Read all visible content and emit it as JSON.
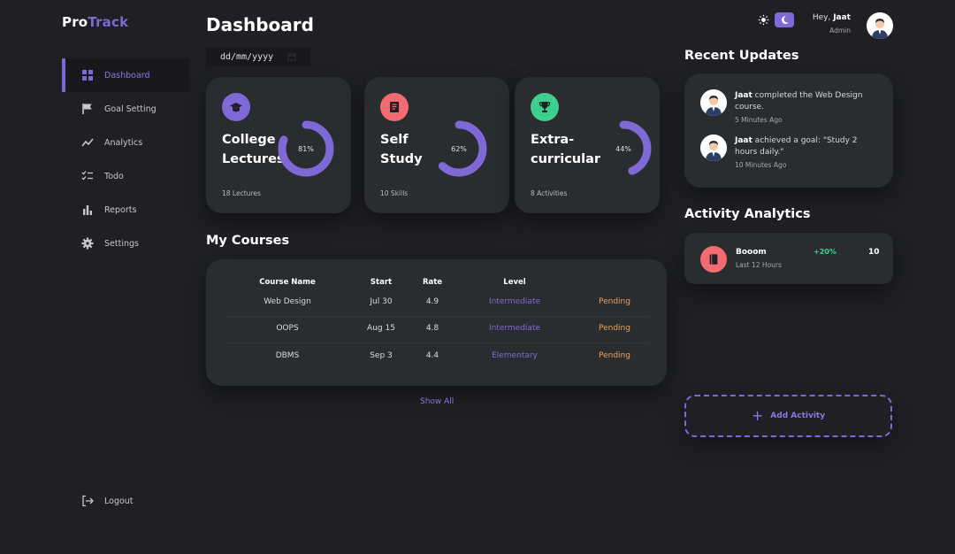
{
  "app": {
    "logo_pro": "Pro",
    "logo_track": "Track"
  },
  "sidebar": {
    "items": [
      {
        "label": "Dashboard",
        "icon": "grid-icon",
        "active": true
      },
      {
        "label": "Goal Setting",
        "icon": "flag-icon"
      },
      {
        "label": "Analytics",
        "icon": "line-chart-icon"
      },
      {
        "label": "Todo",
        "icon": "checklist-icon"
      },
      {
        "label": "Reports",
        "icon": "bar-chart-icon"
      },
      {
        "label": "Settings",
        "icon": "gear-icon"
      }
    ],
    "logout_label": "Logout"
  },
  "header": {
    "title": "Dashboard",
    "date_placeholder": "dd/mm/yyyy",
    "greeting_prefix": "Hey,",
    "user_name": "Jaat",
    "user_role": "Admin"
  },
  "cards": [
    {
      "title": "College Lectures",
      "subtitle": "18 Lectures",
      "percent_label": "81%",
      "percent": 81,
      "badge_color": "#7f69d6",
      "icon": "graduation-cap-icon"
    },
    {
      "title": "Self Study",
      "subtitle": "10 Skills",
      "percent_label": "62%",
      "percent": 62,
      "badge_color": "#f36a73",
      "icon": "book-icon"
    },
    {
      "title": "Extra-curricular",
      "subtitle": "8 Activities",
      "percent_label": "44%",
      "percent": 44,
      "badge_color": "#3ecf8e",
      "icon": "trophy-icon"
    }
  ],
  "courses": {
    "title": "My Courses",
    "headers": [
      "Course Name",
      "Start",
      "Rate",
      "Level"
    ],
    "rows": [
      {
        "name": "Web Design",
        "start": "Jul 30",
        "rate": "4.9",
        "level": "Intermediate",
        "status": "Pending"
      },
      {
        "name": "OOPS",
        "start": "Aug 15",
        "rate": "4.8",
        "level": "Intermediate",
        "status": "Pending"
      },
      {
        "name": "DBMS",
        "start": "Sep 3",
        "rate": "4.4",
        "level": "Elementary",
        "status": "Pending"
      }
    ],
    "show_all": "Show All"
  },
  "updates": {
    "title": "Recent Updates",
    "items": [
      {
        "user": "Jaat",
        "text": " completed the Web Design course.",
        "time": "5 Minutes Ago"
      },
      {
        "user": "Jaat",
        "text": " achieved a goal: \"Study 2 hours daily.\"",
        "time": "10 Minutes Ago"
      }
    ]
  },
  "analytics": {
    "title": "Activity Analytics",
    "item": {
      "name": "Booom",
      "time": "Last 12 Hours",
      "change": "+20%",
      "value": "10"
    }
  },
  "add_activity_label": "Add Activity",
  "colors": {
    "accent": "#7f69d6",
    "background": "#1f2024",
    "card": "#2a2d2f",
    "pending": "#f0a05a",
    "positive": "#3ecf8e"
  }
}
